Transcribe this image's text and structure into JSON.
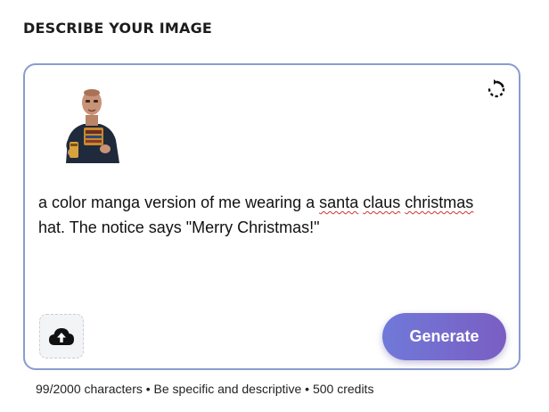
{
  "section": {
    "heading": "DESCRIBE YOUR IMAGE"
  },
  "prompt": {
    "text_before": "a color manga version of me wearing a ",
    "misspelled_1": "santa",
    "space_1": " ",
    "misspelled_2": "claus",
    "space_2": " ",
    "misspelled_3": "christmas",
    "text_after": " hat. The notice says \"Merry Christmas!\""
  },
  "icons": {
    "reset": "rotate-ccw-icon",
    "upload": "cloud-upload-icon",
    "thumbnail": "user-photo-thumbnail"
  },
  "actions": {
    "generate_label": "Generate"
  },
  "footer": {
    "text": "99/2000 characters • Be specific and descriptive • 500 credits"
  },
  "colors": {
    "box_border": "#8a9cd0",
    "generate_start": "#7079d9",
    "generate_end": "#7a5ec2",
    "spellcheck": "#d0342c"
  }
}
